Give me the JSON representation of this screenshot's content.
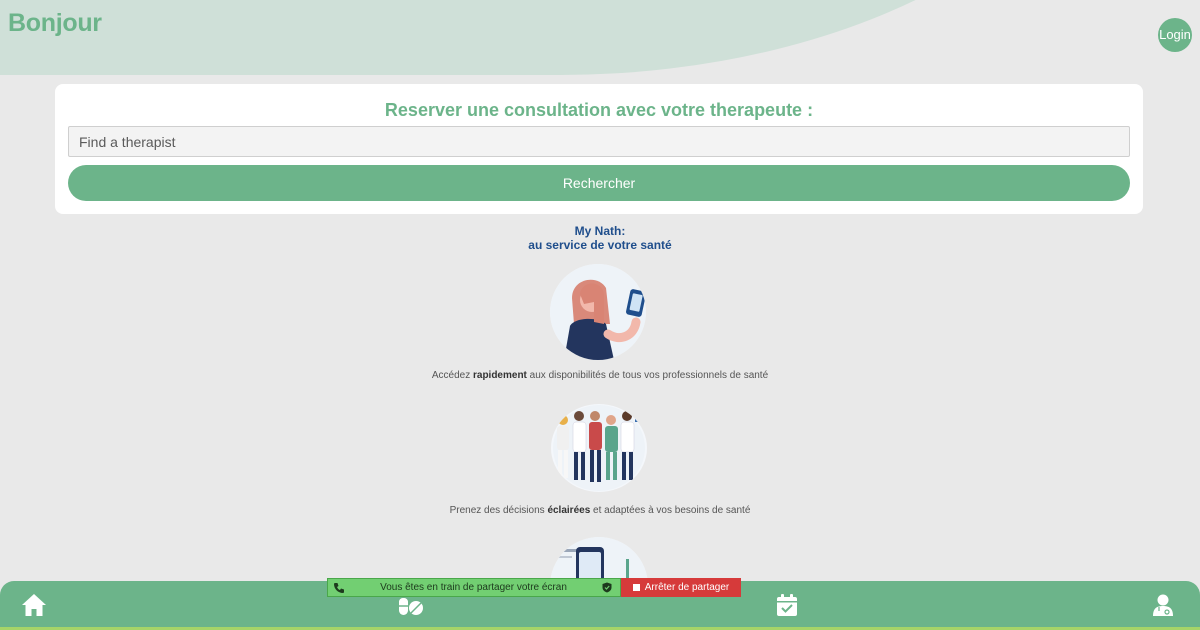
{
  "header": {
    "greeting": "Bonjour",
    "login_label": "Login"
  },
  "search": {
    "title": "Reserver une consultation avec votre therapeute :",
    "placeholder": "Find a therapist",
    "button_label": "Rechercher"
  },
  "promo": {
    "title_line1": "My Nath:",
    "title_line2": "au service de votre santé",
    "items": [
      {
        "before": "Accédez ",
        "bold": "rapidement",
        "after": " aux disponibilités de tous vos professionnels de santé",
        "icon": "woman-phone-illustration"
      },
      {
        "before": "Prenez des décisions ",
        "bold": "éclairées",
        "after": " et adaptées à vos besoins de santé",
        "icon": "health-team-illustration"
      },
      {
        "icon": "phone-app-illustration"
      }
    ]
  },
  "bottom_nav": {
    "items": [
      {
        "icon": "home-icon"
      },
      {
        "icon": "pills-icon"
      },
      {
        "icon": "calendar-check-icon"
      },
      {
        "icon": "doctor-icon"
      }
    ]
  },
  "share_bar": {
    "status_text": "Vous êtes en train de partager votre écran",
    "stop_label": "Arrêter de partager"
  },
  "colors": {
    "brand": "#6cb48a",
    "accent_blue": "#1f4e8c",
    "background": "#e9e9e9"
  }
}
